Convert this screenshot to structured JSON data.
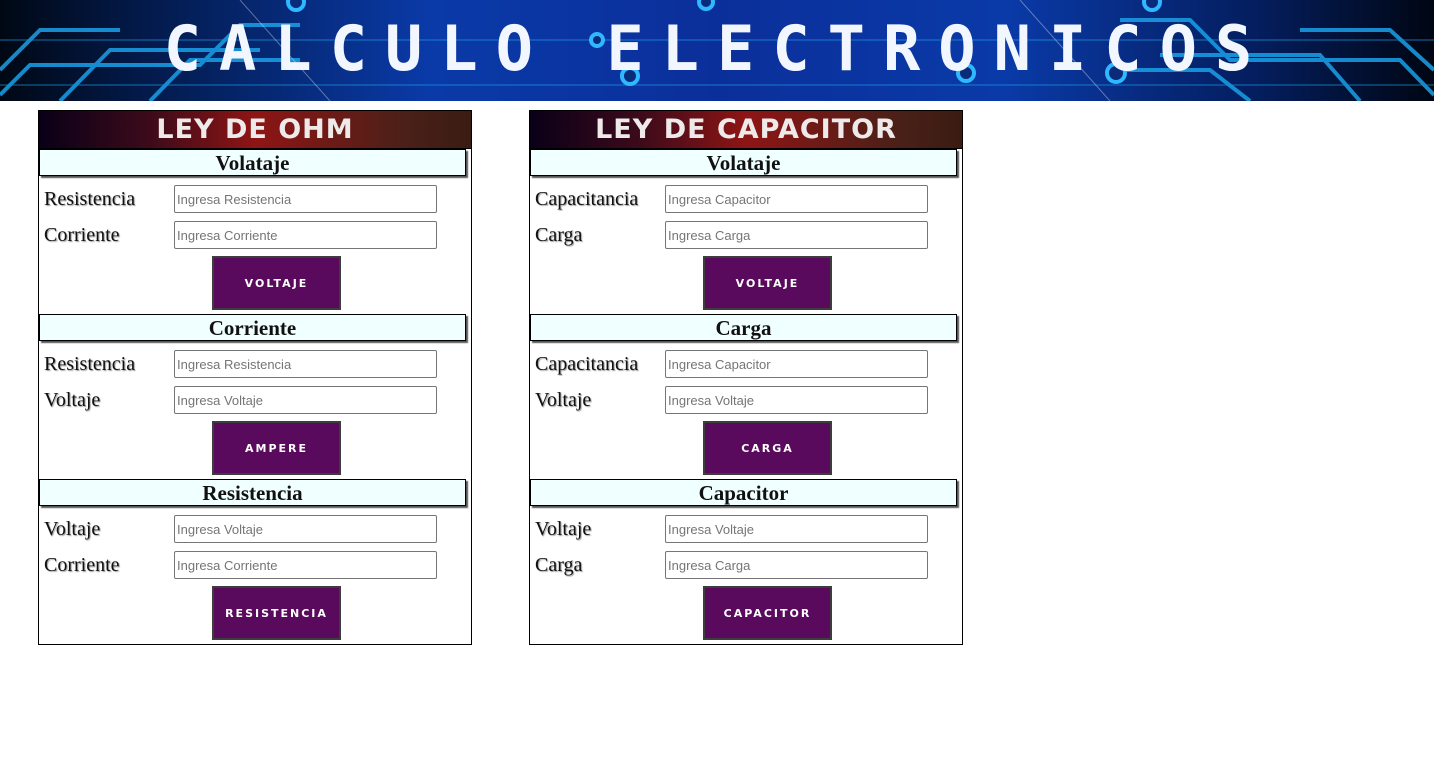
{
  "banner": {
    "title": "CALCULO ELECTRONICOS"
  },
  "colors": {
    "button": "#5a0a5c",
    "section_bg": "#f0ffff",
    "banner_blue": "#0b2f9a"
  },
  "ohm": {
    "title": "LEY DE OHM",
    "sections": [
      {
        "title": "Volataje",
        "fields": [
          {
            "label": "Resistencia",
            "placeholder": "Ingresa Resistencia"
          },
          {
            "label": "Corriente",
            "placeholder": "Ingresa Corriente"
          }
        ],
        "button": "VOLTAJE"
      },
      {
        "title": "Corriente",
        "fields": [
          {
            "label": "Resistencia",
            "placeholder": "Ingresa Resistencia"
          },
          {
            "label": "Voltaje",
            "placeholder": "Ingresa Voltaje"
          }
        ],
        "button": "AMPERE"
      },
      {
        "title": "Resistencia",
        "fields": [
          {
            "label": "Voltaje",
            "placeholder": "Ingresa Voltaje"
          },
          {
            "label": "Corriente",
            "placeholder": "Ingresa Corriente"
          }
        ],
        "button": "RESISTENCIA"
      }
    ]
  },
  "capacitor": {
    "title": "LEY DE CAPACITOR",
    "sections": [
      {
        "title": "Volataje",
        "fields": [
          {
            "label": "Capacitancia",
            "placeholder": "Ingresa Capacitor"
          },
          {
            "label": "Carga",
            "placeholder": "Ingresa Carga"
          }
        ],
        "button": "VOLTAJE"
      },
      {
        "title": "Carga",
        "fields": [
          {
            "label": "Capacitancia",
            "placeholder": "Ingresa Capacitor"
          },
          {
            "label": "Voltaje",
            "placeholder": "Ingresa Voltaje"
          }
        ],
        "button": "CARGA"
      },
      {
        "title": "Capacitor",
        "fields": [
          {
            "label": "Voltaje",
            "placeholder": "Ingresa Voltaje"
          },
          {
            "label": "Carga",
            "placeholder": "Ingresa Carga"
          }
        ],
        "button": "CAPACITOR"
      }
    ]
  }
}
